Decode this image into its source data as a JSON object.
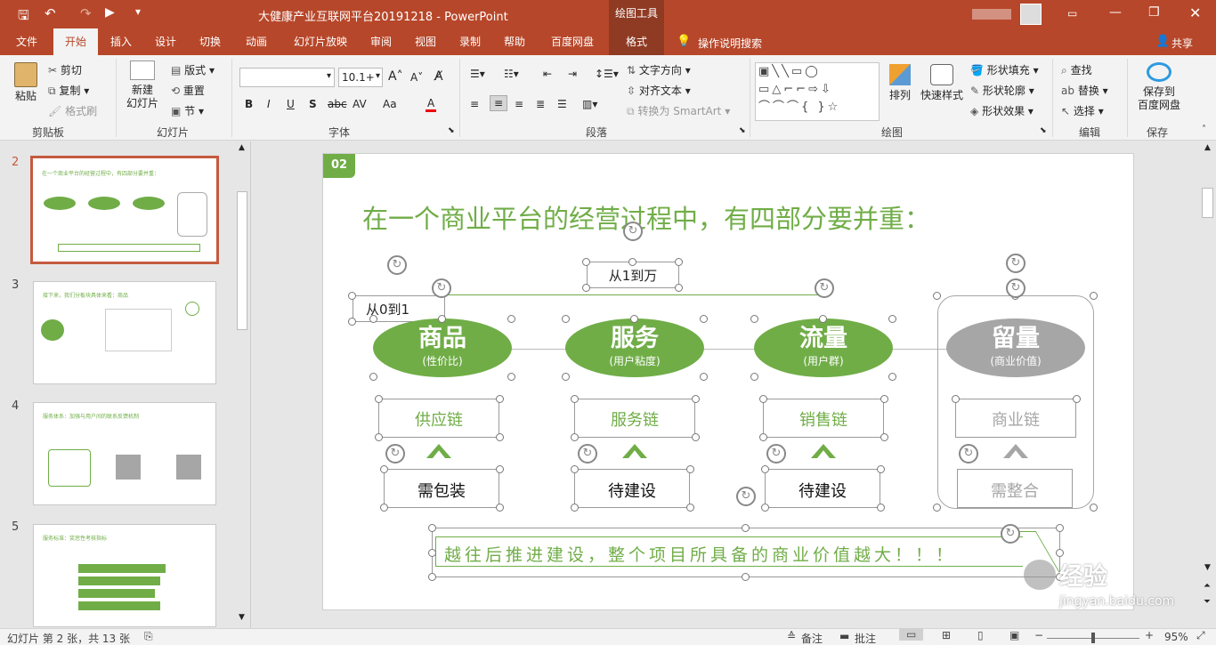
{
  "window": {
    "title": "大健康产业互联网平台20191218  -  PowerPoint",
    "context_tab": "绘图工具"
  },
  "tabs": [
    "文件",
    "开始",
    "插入",
    "设计",
    "切换",
    "动画",
    "幻灯片放映",
    "审阅",
    "视图",
    "录制",
    "帮助",
    "百度网盘",
    "格式"
  ],
  "tell_me": "操作说明搜索",
  "share": "共享",
  "ribbon": {
    "clipboard": {
      "group": "剪贴板",
      "paste": "粘贴",
      "cut": "剪切",
      "copy": "复制",
      "format_painter": "格式刷"
    },
    "slides": {
      "group": "幻灯片",
      "new_slide": "新建\n幻灯片",
      "layout": "版式",
      "reset": "重置",
      "section": "节"
    },
    "font": {
      "group": "字体",
      "font_name": "",
      "font_size": "10.1+",
      "bold": "B",
      "italic": "I",
      "underline": "U",
      "shadow": "S",
      "spacing": "AV",
      "case": "Aa",
      "color": "A"
    },
    "paragraph": {
      "group": "段落",
      "text_direction": "文字方向",
      "align_text": "对齐文本",
      "smartart": "转换为 SmartArt"
    },
    "drawing": {
      "group": "绘图",
      "arrange": "排列",
      "quick_styles": "快速样式",
      "shape_fill": "形状填充",
      "shape_outline": "形状轮廓",
      "shape_effects": "形状效果"
    },
    "editing": {
      "group": "编辑",
      "find": "查找",
      "replace": "替换",
      "select": "选择"
    },
    "save": {
      "group": "保存",
      "save_to": "保存到\n百度网盘"
    }
  },
  "thumbnails": [
    {
      "num": "2",
      "title": "在一个商业平台的经营过程中，有四部分要并重："
    },
    {
      "num": "3",
      "title": "接下来，我们分板块具体来看：商品"
    },
    {
      "num": "4",
      "title": "服务体系：加强与用户间的联系反馈机制"
    },
    {
      "num": "5",
      "title": "服务标准：奖惩性考核指标"
    }
  ],
  "slide": {
    "badge": "02",
    "title": "在一个商业平台的经营过程中，有四部分要并重：",
    "top_label": "从1到万",
    "left_label": "从0到1",
    "pillars": [
      {
        "name": "商品",
        "sub": "(性价比)",
        "chain": "供应链",
        "status": "需包装"
      },
      {
        "name": "服务",
        "sub": "(用户粘度)",
        "chain": "服务链",
        "status": "待建设"
      },
      {
        "name": "流量",
        "sub": "(用户群)",
        "chain": "销售链",
        "status": "待建设"
      },
      {
        "name": "留量",
        "sub": "(商业价值)",
        "chain": "商业链",
        "status": "需整合"
      }
    ],
    "banner": "越往后推进建设，整个项目所具备的商业价值越大！！！",
    "colors": {
      "green": "#70ad47",
      "gray": "#a6a6a6",
      "brand": "#b7472a"
    }
  },
  "status": {
    "slide_info": "幻灯片 第 2 张，共 13 张",
    "notes": "备注",
    "comments": "批注",
    "zoom": "95%"
  },
  "watermark": {
    "text": "经验",
    "url": "jingyan.baidu.com"
  }
}
